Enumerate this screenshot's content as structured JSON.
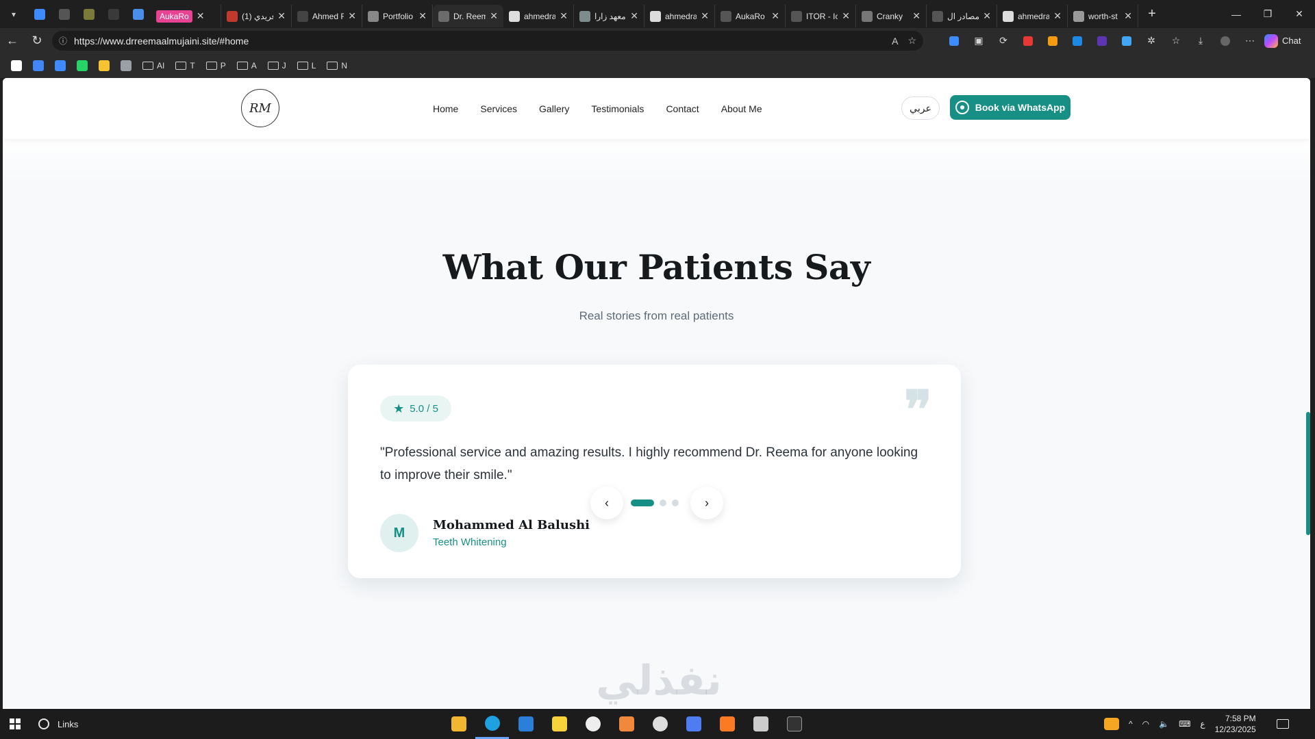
{
  "browser": {
    "tabs": [
      {
        "title": "AukaRo",
        "badge": true,
        "color": "#e84393"
      },
      {
        "title": "(1) فريدي",
        "color": "#c0392b"
      },
      {
        "title": "Ahmed R",
        "color": "#444444"
      },
      {
        "title": "Portfolio",
        "color": "#888888"
      },
      {
        "title": "Dr. Reem",
        "color": "#6b6b6b",
        "active": true
      },
      {
        "title": "ahmedra",
        "color": "#dddddd"
      },
      {
        "title": "معهد زارا",
        "color": "#7f8c8d"
      },
      {
        "title": "ahmedra",
        "color": "#dddddd"
      },
      {
        "title": "AukaRo",
        "color": "#555555"
      },
      {
        "title": "ITOR - Ic",
        "color": "#555555"
      },
      {
        "title": "Cranky",
        "color": "#777777"
      },
      {
        "title": "مصادر ال",
        "color": "#555555"
      },
      {
        "title": "ahmedra",
        "color": "#dddddd"
      },
      {
        "title": "worth-st",
        "color": "#999999"
      }
    ],
    "close_glyph": "✕",
    "new_tab_glyph": "+",
    "window_controls": {
      "minimize": "—",
      "maximize": "❐",
      "close": "✕"
    },
    "address": {
      "url": "https://www.drreemaalmujaini.site/#home",
      "read_aloud_glyph": "A",
      "favorite_glyph": "☆"
    },
    "chat_label": "Chat",
    "bookmarks": [
      {
        "label": "",
        "type": "icon",
        "color": "#ffffff"
      },
      {
        "label": "",
        "type": "icon",
        "color": "#4285f4"
      },
      {
        "label": "",
        "type": "icon",
        "color": "#3d8bfd"
      },
      {
        "label": "",
        "type": "icon",
        "color": "#25d366"
      },
      {
        "label": "",
        "type": "icon",
        "color": "#f4c430"
      },
      {
        "label": "",
        "type": "icon",
        "color": "#9aa0a6"
      },
      {
        "label": "AI",
        "type": "folder"
      },
      {
        "label": "T",
        "type": "folder"
      },
      {
        "label": "P",
        "type": "folder"
      },
      {
        "label": "A",
        "type": "folder"
      },
      {
        "label": "J",
        "type": "folder"
      },
      {
        "label": "L",
        "type": "folder"
      },
      {
        "label": "N",
        "type": "folder"
      }
    ]
  },
  "site": {
    "logo_text": "RM",
    "nav": [
      "Home",
      "Services",
      "Gallery",
      "Testimonials",
      "Contact",
      "About Me"
    ],
    "lang_label": "عربي",
    "whatsapp_label": "Book via WhatsApp",
    "accent": "#178f84"
  },
  "testimonials": {
    "title": "What Our Patients Say",
    "subtitle": "Real stories from real patients",
    "rating": "5.0 / 5",
    "quote_glyph": "❞",
    "quote": "\"Professional service and amazing results. I highly recommend Dr. Reema for anyone looking to improve their smile.\"",
    "author": {
      "initial": "M",
      "name": "Mohammed Al Balushi",
      "treatment": "Teeth Whitening"
    },
    "carousel": {
      "prev": "‹",
      "next": "›",
      "slides": 3,
      "active": 1
    }
  },
  "watermark": "نفذلي",
  "taskbar": {
    "search_label": "Links",
    "clock_time": "7:58 PM",
    "clock_date": "12/23/2025",
    "lang_indicator": "ع",
    "tray_arrow": "^"
  }
}
